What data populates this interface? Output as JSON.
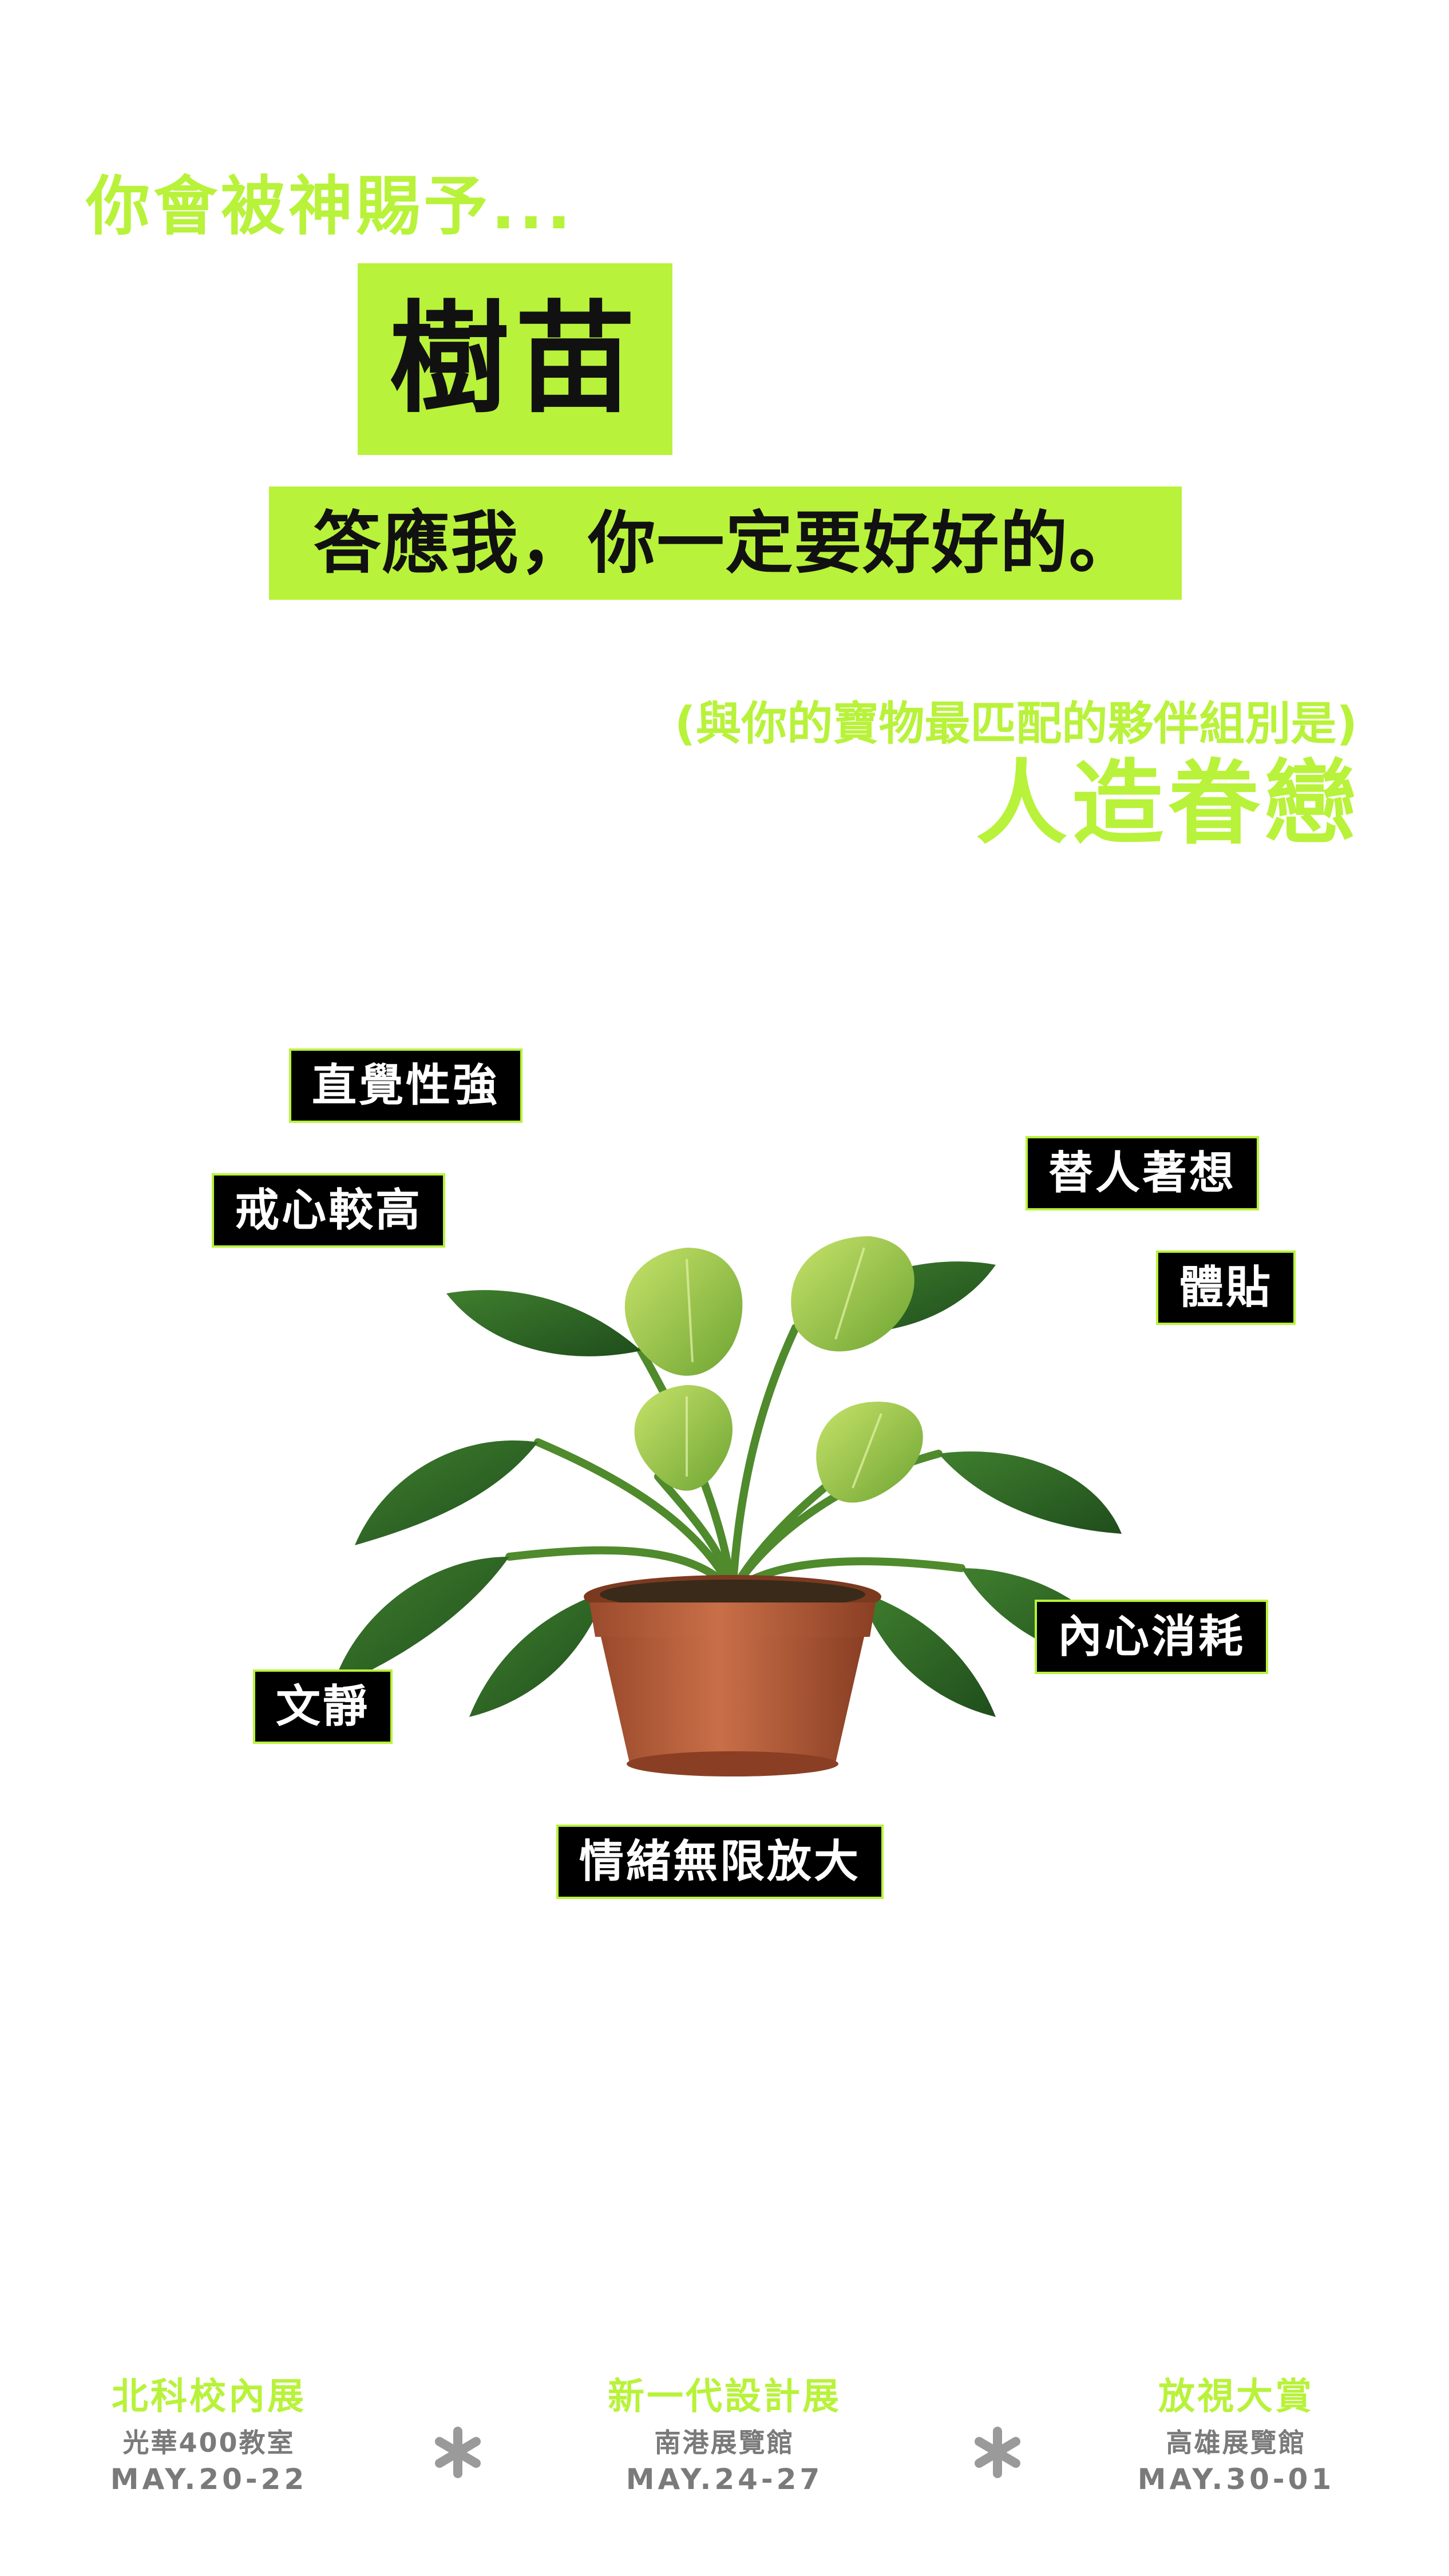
{
  "intro_text": "你會被神賜予...",
  "gift_name": "樹苗",
  "promise_text": "答應我，你一定要好好的。",
  "partner": {
    "note": "(與你的寶物最匹配的夥伴組別是)",
    "name": "人造眷戀"
  },
  "traits": [
    "直覺性強",
    "戒心較高",
    "替人著想",
    "體貼",
    "內心消耗",
    "文靜",
    "情緒無限放大"
  ],
  "footer": [
    {
      "title": "北科校內展",
      "venue": "光華400教室",
      "date": "MAY.20-22"
    },
    {
      "title": "新一代設計展",
      "venue": "南港展覽館",
      "date": "MAY.24-27"
    },
    {
      "title": "放視大賞",
      "venue": "高雄展覽館",
      "date": "MAY.30-01"
    }
  ],
  "colors": {
    "accent": "#b8f23a",
    "tag_background": "#000000",
    "footer_text": "#7a7a7a"
  },
  "icons": {
    "illustration": "potted-plant-illustration",
    "separator": "asterisk-icon"
  }
}
